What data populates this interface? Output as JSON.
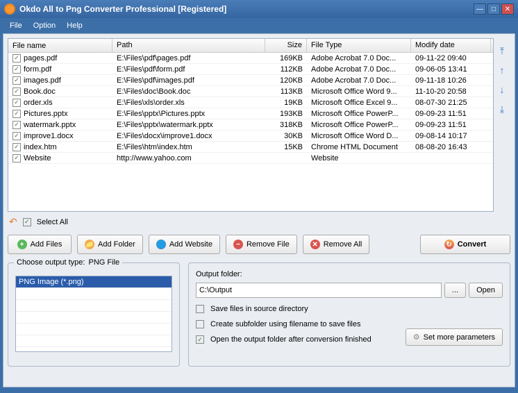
{
  "window": {
    "title": "Okdo All to Png Converter Professional [Registered]"
  },
  "menu": {
    "file": "File",
    "option": "Option",
    "help": "Help"
  },
  "filelist": {
    "headers": {
      "name": "File name",
      "path": "Path",
      "size": "Size",
      "type": "File Type",
      "date": "Modify date"
    },
    "rows": [
      {
        "name": "pages.pdf",
        "path": "E:\\Files\\pdf\\pages.pdf",
        "size": "169KB",
        "type": "Adobe Acrobat 7.0 Doc...",
        "date": "09-11-22 09:40"
      },
      {
        "name": "form.pdf",
        "path": "E:\\Files\\pdf\\form.pdf",
        "size": "112KB",
        "type": "Adobe Acrobat 7.0 Doc...",
        "date": "09-06-05 13:41"
      },
      {
        "name": "images.pdf",
        "path": "E:\\Files\\pdf\\images.pdf",
        "size": "120KB",
        "type": "Adobe Acrobat 7.0 Doc...",
        "date": "09-11-18 10:26"
      },
      {
        "name": "Book.doc",
        "path": "E:\\Files\\doc\\Book.doc",
        "size": "113KB",
        "type": "Microsoft Office Word 9...",
        "date": "11-10-20 20:58"
      },
      {
        "name": "order.xls",
        "path": "E:\\Files\\xls\\order.xls",
        "size": "19KB",
        "type": "Microsoft Office Excel 9...",
        "date": "08-07-30 21:25"
      },
      {
        "name": "Pictures.pptx",
        "path": "E:\\Files\\pptx\\Pictures.pptx",
        "size": "193KB",
        "type": "Microsoft Office PowerP...",
        "date": "09-09-23 11:51"
      },
      {
        "name": "watermark.pptx",
        "path": "E:\\Files\\pptx\\watermark.pptx",
        "size": "318KB",
        "type": "Microsoft Office PowerP...",
        "date": "09-09-23 11:51"
      },
      {
        "name": "improve1.docx",
        "path": "E:\\Files\\docx\\improve1.docx",
        "size": "30KB",
        "type": "Microsoft Office Word D...",
        "date": "09-08-14 10:17"
      },
      {
        "name": "index.htm",
        "path": "E:\\Files\\htm\\index.htm",
        "size": "15KB",
        "type": "Chrome HTML Document",
        "date": "08-08-20 16:43"
      },
      {
        "name": "Website",
        "path": "http://www.yahoo.com",
        "size": "",
        "type": "Website",
        "date": ""
      }
    ]
  },
  "selectall": {
    "label": "Select All",
    "checked": "✓"
  },
  "toolbar": {
    "add_files": "Add Files",
    "add_folder": "Add Folder",
    "add_website": "Add Website",
    "remove_file": "Remove File",
    "remove_all": "Remove All",
    "convert": "Convert"
  },
  "output_type": {
    "label": "Choose output type:",
    "value": "PNG File",
    "option": "PNG Image (*.png)"
  },
  "output": {
    "label": "Output folder:",
    "path": "C:\\Output",
    "browse": "...",
    "open": "Open",
    "save_source": "Save files in source directory",
    "create_sub": "Create subfolder using filename to save files",
    "open_after": "Open the output folder after conversion finished",
    "more_params": "Set more parameters"
  }
}
